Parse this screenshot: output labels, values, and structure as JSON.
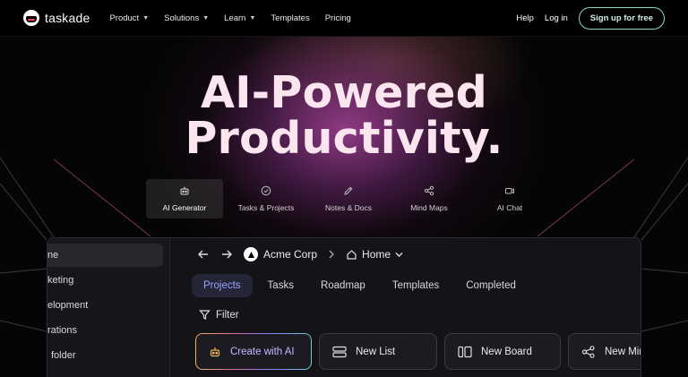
{
  "brand": {
    "name": "taskade"
  },
  "nav": {
    "links": [
      {
        "label": "Product",
        "has_menu": true
      },
      {
        "label": "Solutions",
        "has_menu": true
      },
      {
        "label": "Learn",
        "has_menu": true
      },
      {
        "label": "Templates",
        "has_menu": false
      },
      {
        "label": "Pricing",
        "has_menu": false
      }
    ],
    "help": "Help",
    "login": "Log in",
    "signup": "Sign up for free"
  },
  "hero": {
    "line1": "AI-Powered",
    "line2": "Productivity."
  },
  "feature_tabs": [
    {
      "label": "AI Generator",
      "icon": "robot-icon",
      "active": true
    },
    {
      "label": "Tasks & Projects",
      "icon": "check-circle-icon",
      "active": false
    },
    {
      "label": "Notes & Docs",
      "icon": "pen-icon",
      "active": false
    },
    {
      "label": "Mind Maps",
      "icon": "share-nodes-icon",
      "active": false
    },
    {
      "label": "AI Chat",
      "icon": "video-icon",
      "active": false
    }
  ],
  "app": {
    "sidebar": [
      {
        "label": "ne",
        "active": true
      },
      {
        "label": "keting",
        "active": false
      },
      {
        "label": "elopment",
        "active": false
      },
      {
        "label": "rations",
        "active": false
      },
      {
        "label": "folder",
        "active": false
      }
    ],
    "breadcrumb": {
      "org": "Acme Corp",
      "page": "Home"
    },
    "view_tabs": [
      {
        "label": "Projects",
        "active": true
      },
      {
        "label": "Tasks",
        "active": false
      },
      {
        "label": "Roadmap",
        "active": false
      },
      {
        "label": "Templates",
        "active": false
      },
      {
        "label": "Completed",
        "active": false
      }
    ],
    "filter_label": "Filter",
    "actions": [
      {
        "label": "Create with AI",
        "icon": "robot-icon"
      },
      {
        "label": "New List",
        "icon": "list-icon"
      },
      {
        "label": "New Board",
        "icon": "board-icon"
      },
      {
        "label": "New Mind",
        "icon": "mindmap-icon"
      }
    ]
  },
  "colors": {
    "accent": "#9aa1ff",
    "signup_border": "#8fd9b6",
    "hero_glow": "#963c8c"
  }
}
